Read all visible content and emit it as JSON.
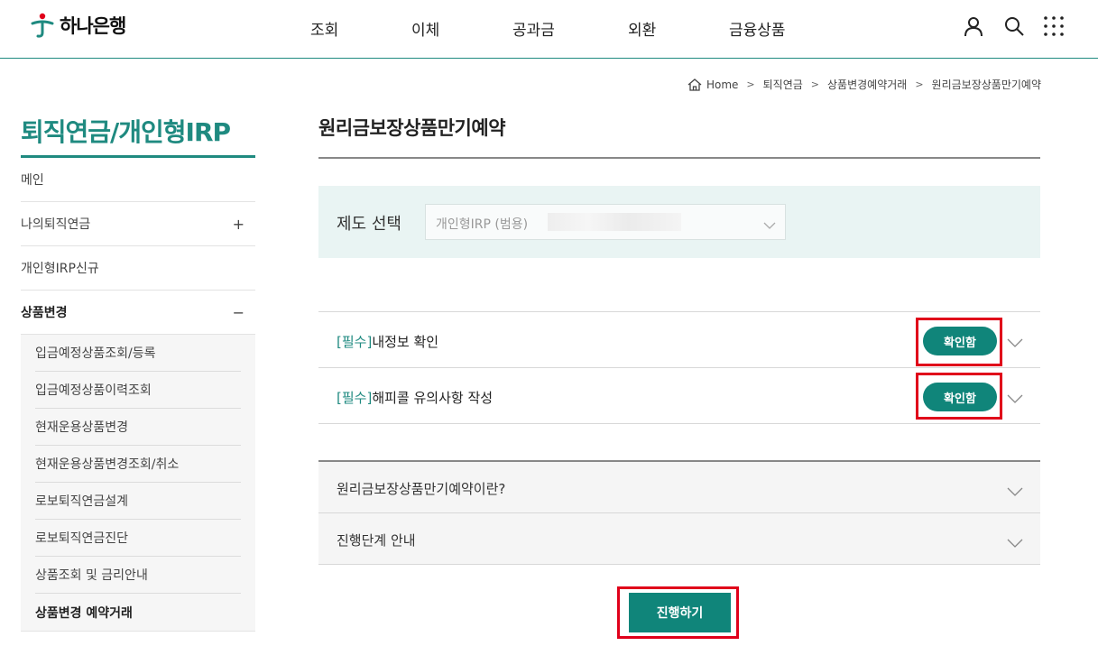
{
  "header": {
    "logo_text": "하나은행",
    "nav": [
      {
        "label": "조회"
      },
      {
        "label": "이체"
      },
      {
        "label": "공과금"
      },
      {
        "label": "외환"
      },
      {
        "label": "금융상품"
      }
    ],
    "icons": [
      "user-icon",
      "search-icon",
      "menu-grid-icon"
    ]
  },
  "breadcrumb": [
    "Home",
    "퇴직연금",
    "상품변경예약거래",
    "원리금보장상품만기예약"
  ],
  "sidebar": {
    "title": "퇴직연금/개인형IRP",
    "items": [
      {
        "label": "메인",
        "toggle": ""
      },
      {
        "label": "나의퇴직연금",
        "toggle": "+"
      },
      {
        "label": "개인형IRP신규",
        "toggle": ""
      },
      {
        "label": "상품변경",
        "toggle": "−"
      }
    ],
    "sub_items": [
      {
        "label": "입금예정상품조회/등록"
      },
      {
        "label": "입금예정상품이력조회"
      },
      {
        "label": "현재운용상품변경"
      },
      {
        "label": "현재운용상품변경조회/취소"
      },
      {
        "label": "로보퇴직연금설계"
      },
      {
        "label": "로보퇴직연금진단"
      },
      {
        "label": "상품조회 및 금리안내"
      },
      {
        "label": "상품변경 예약거래"
      }
    ]
  },
  "main": {
    "title": "원리금보장상품만기예약",
    "select": {
      "label": "제도 선택",
      "value": "개인형IRP (범용)"
    },
    "agreements": [
      {
        "tag": "[필수]",
        "label": "내정보 확인",
        "button": "확인함"
      },
      {
        "tag": "[필수]",
        "label": "해피콜 유의사항 작성",
        "button": "확인함"
      }
    ],
    "info": [
      {
        "label": "원리금보장상품만기예약이란?"
      },
      {
        "label": "진행단계 안내"
      }
    ],
    "proceed_button": "진행하기"
  },
  "colors": {
    "brand": "#1f8a80",
    "button": "#10857a",
    "highlight": "#e0001a"
  }
}
